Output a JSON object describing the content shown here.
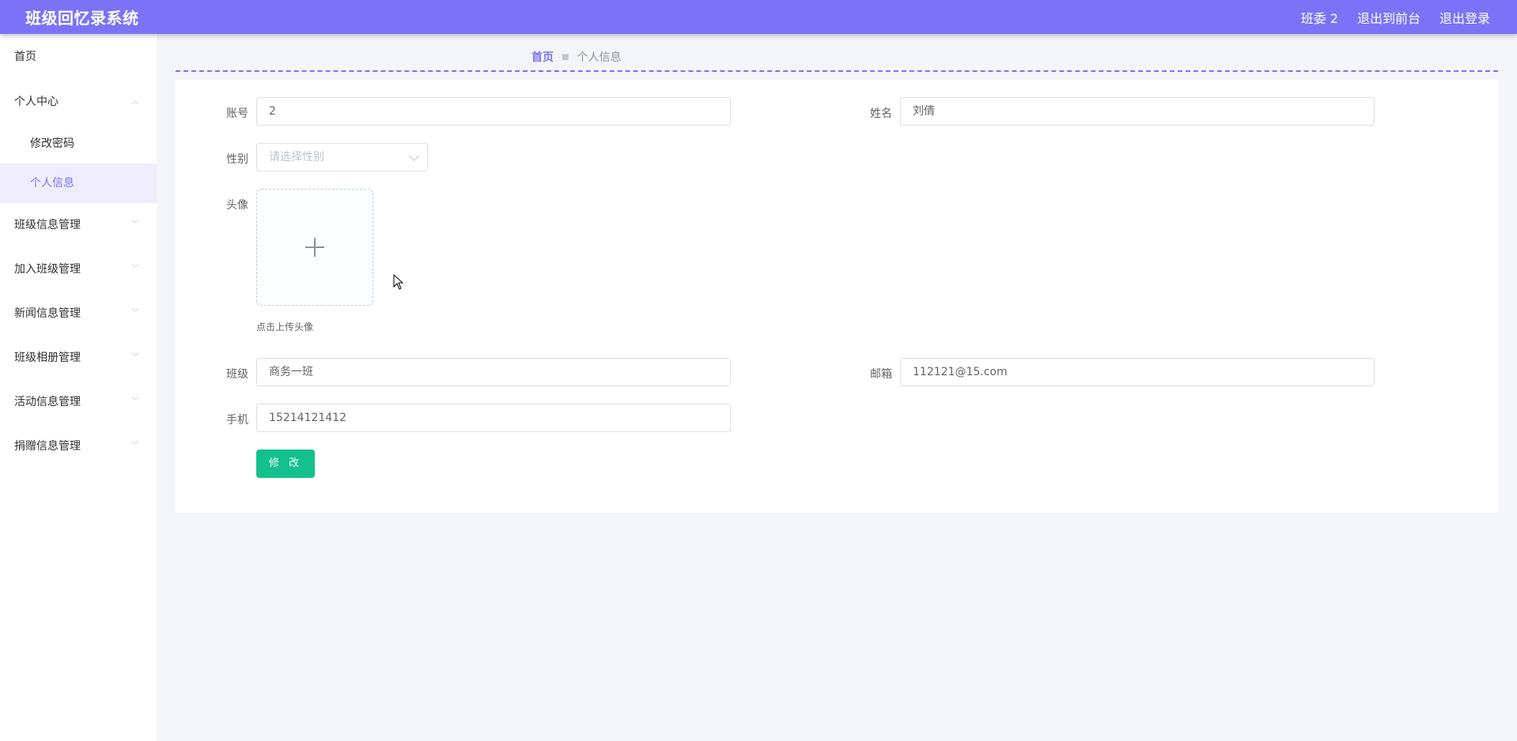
{
  "header": {
    "title": "班级回忆录系统",
    "role": "班委 2",
    "exit_front": "退出到前台",
    "logout": "退出登录",
    "accent_color": "#7b72f7"
  },
  "sidebar": {
    "home": "首页",
    "personal_center": "个人中心",
    "sub_items": [
      "修改密码",
      "个人信息"
    ],
    "menus": [
      "班级信息管理",
      "加入班级管理",
      "新闻信息管理",
      "班级相册管理",
      "活动信息管理",
      "捐赠信息管理"
    ]
  },
  "breadcrumb": {
    "home": "首页",
    "current": "个人信息"
  },
  "form": {
    "account_label": "账号",
    "account_value": "2",
    "name_label": "姓名",
    "name_value": "刘倩",
    "gender_label": "性别",
    "gender_placeholder": "请选择性别",
    "avatar_label": "头像",
    "avatar_tip": "点击上传头像",
    "class_label": "班级",
    "class_value": "商务一班",
    "email_label": "邮箱",
    "email_value": "112121@15.com",
    "phone_label": "手机",
    "phone_value": "15214121412",
    "submit_label": "修 改",
    "submit_color": "#14c08e"
  }
}
